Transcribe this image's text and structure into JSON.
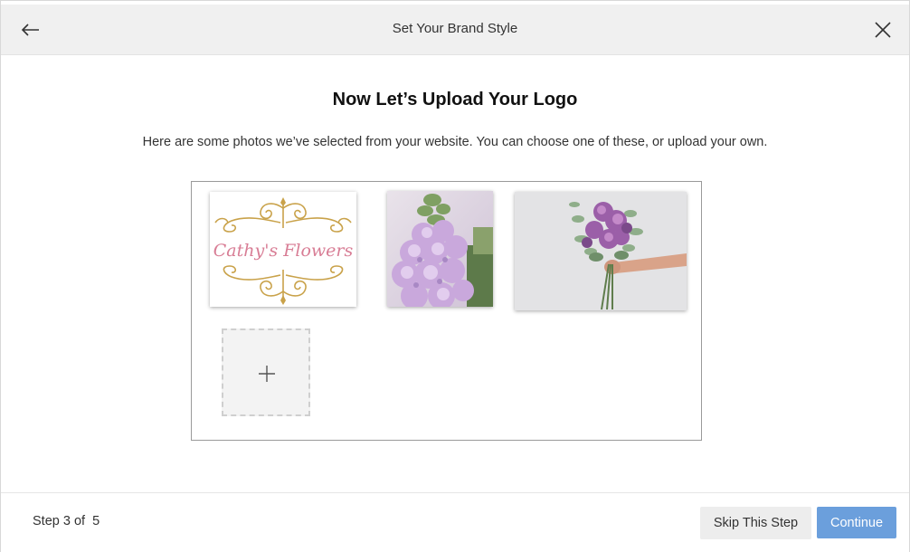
{
  "header": {
    "title": "Set Your Brand Style",
    "back_icon": "back-arrow-icon",
    "close_icon": "close-icon"
  },
  "main": {
    "heading": "Now Let’s Upload Your Logo",
    "subtext": "Here are some photos we’ve selected from your website. You can choose one of these, or upload your own.",
    "photos": [
      {
        "type": "logo",
        "logo_text": "Cathy's Flowers"
      },
      {
        "type": "photo",
        "subject": "lilac stock flowers close-up"
      },
      {
        "type": "photo",
        "subject": "hand holding purple bouquet"
      }
    ],
    "upload_icon": "plus-icon"
  },
  "footer": {
    "step_label": "Step 3 of  5",
    "skip_label": "Skip This Step",
    "continue_label": "Continue"
  },
  "colors": {
    "header_bg": "#f0f0f0",
    "primary_button": "#6b9fdc",
    "secondary_button": "#ededed",
    "logo_gold": "#c9a24a",
    "logo_pink": "#d87d95"
  }
}
